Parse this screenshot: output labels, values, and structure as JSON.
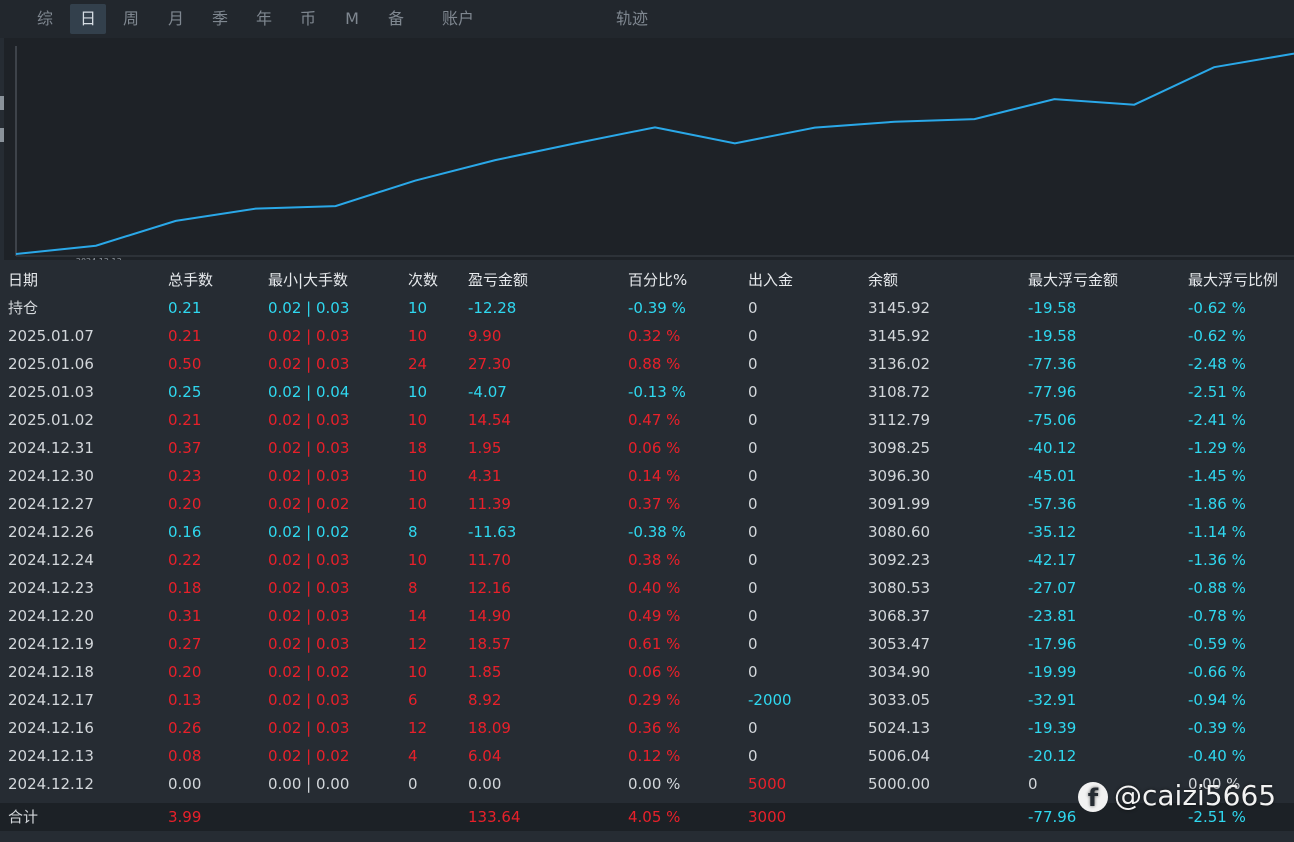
{
  "tabs": [
    {
      "label": "综",
      "active": false
    },
    {
      "label": "日",
      "active": true
    },
    {
      "label": "周",
      "active": false
    },
    {
      "label": "月",
      "active": false
    },
    {
      "label": "季",
      "active": false
    },
    {
      "label": "年",
      "active": false
    },
    {
      "label": "币",
      "active": false
    },
    {
      "label": "M",
      "active": false
    },
    {
      "label": "备",
      "active": false
    },
    {
      "label": "账户",
      "active": false
    },
    {
      "label": "轨迹",
      "active": false
    }
  ],
  "chart_data": {
    "type": "line",
    "x_tick_label": "2024.12.13",
    "x": [
      "2024.12.12",
      "2024.12.13",
      "2024.12.16",
      "2024.12.17",
      "2024.12.18",
      "2024.12.19",
      "2024.12.20",
      "2024.12.23",
      "2024.12.24",
      "2024.12.26",
      "2024.12.27",
      "2024.12.30",
      "2024.12.31",
      "2025.01.02",
      "2025.01.03",
      "2025.01.06",
      "2025.01.07"
    ],
    "y": [
      0,
      6.04,
      24.13,
      33.05,
      34.9,
      53.47,
      68.37,
      80.53,
      92.23,
      80.6,
      91.99,
      96.3,
      98.25,
      112.79,
      108.72,
      136.02,
      145.92
    ],
    "line_color": "#2aa8e8",
    "ylim": [
      0,
      150
    ]
  },
  "table": {
    "headers": [
      "日期",
      "总手数",
      "最小|大手数",
      "次数",
      "盈亏金额",
      "百分比%",
      "出入金",
      "余额",
      "最大浮亏金额",
      "最大浮亏比例"
    ],
    "rows": [
      {
        "date": "持仓",
        "lots": "0.21",
        "minmax": "0.02 | 0.03",
        "count": "10",
        "pnl": "-12.28",
        "pct": "-0.39 %",
        "flow": "0",
        "balance": "3145.92",
        "mdd": "-19.58",
        "mddpct": "-0.62 %",
        "color": "cyan"
      },
      {
        "date": "2025.01.07",
        "lots": "0.21",
        "minmax": "0.02 | 0.03",
        "count": "10",
        "pnl": "9.90",
        "pct": "0.32 %",
        "flow": "0",
        "balance": "3145.92",
        "mdd": "-19.58",
        "mddpct": "-0.62 %",
        "color": "red"
      },
      {
        "date": "2025.01.06",
        "lots": "0.50",
        "minmax": "0.02 | 0.03",
        "count": "24",
        "pnl": "27.30",
        "pct": "0.88 %",
        "flow": "0",
        "balance": "3136.02",
        "mdd": "-77.36",
        "mddpct": "-2.48 %",
        "color": "red"
      },
      {
        "date": "2025.01.03",
        "lots": "0.25",
        "minmax": "0.02 | 0.04",
        "count": "10",
        "pnl": "-4.07",
        "pct": "-0.13 %",
        "flow": "0",
        "balance": "3108.72",
        "mdd": "-77.96",
        "mddpct": "-2.51 %",
        "color": "cyan"
      },
      {
        "date": "2025.01.02",
        "lots": "0.21",
        "minmax": "0.02 | 0.03",
        "count": "10",
        "pnl": "14.54",
        "pct": "0.47 %",
        "flow": "0",
        "balance": "3112.79",
        "mdd": "-75.06",
        "mddpct": "-2.41 %",
        "color": "red"
      },
      {
        "date": "2024.12.31",
        "lots": "0.37",
        "minmax": "0.02 | 0.03",
        "count": "18",
        "pnl": "1.95",
        "pct": "0.06 %",
        "flow": "0",
        "balance": "3098.25",
        "mdd": "-40.12",
        "mddpct": "-1.29 %",
        "color": "red"
      },
      {
        "date": "2024.12.30",
        "lots": "0.23",
        "minmax": "0.02 | 0.03",
        "count": "10",
        "pnl": "4.31",
        "pct": "0.14 %",
        "flow": "0",
        "balance": "3096.30",
        "mdd": "-45.01",
        "mddpct": "-1.45 %",
        "color": "red"
      },
      {
        "date": "2024.12.27",
        "lots": "0.20",
        "minmax": "0.02 | 0.02",
        "count": "10",
        "pnl": "11.39",
        "pct": "0.37 %",
        "flow": "0",
        "balance": "3091.99",
        "mdd": "-57.36",
        "mddpct": "-1.86 %",
        "color": "red"
      },
      {
        "date": "2024.12.26",
        "lots": "0.16",
        "minmax": "0.02 | 0.02",
        "count": "8",
        "pnl": "-11.63",
        "pct": "-0.38 %",
        "flow": "0",
        "balance": "3080.60",
        "mdd": "-35.12",
        "mddpct": "-1.14 %",
        "color": "cyan"
      },
      {
        "date": "2024.12.24",
        "lots": "0.22",
        "minmax": "0.02 | 0.03",
        "count": "10",
        "pnl": "11.70",
        "pct": "0.38 %",
        "flow": "0",
        "balance": "3092.23",
        "mdd": "-42.17",
        "mddpct": "-1.36 %",
        "color": "red"
      },
      {
        "date": "2024.12.23",
        "lots": "0.18",
        "minmax": "0.02 | 0.03",
        "count": "8",
        "pnl": "12.16",
        "pct": "0.40 %",
        "flow": "0",
        "balance": "3080.53",
        "mdd": "-27.07",
        "mddpct": "-0.88 %",
        "color": "red"
      },
      {
        "date": "2024.12.20",
        "lots": "0.31",
        "minmax": "0.02 | 0.03",
        "count": "14",
        "pnl": "14.90",
        "pct": "0.49 %",
        "flow": "0",
        "balance": "3068.37",
        "mdd": "-23.81",
        "mddpct": "-0.78 %",
        "color": "red"
      },
      {
        "date": "2024.12.19",
        "lots": "0.27",
        "minmax": "0.02 | 0.03",
        "count": "12",
        "pnl": "18.57",
        "pct": "0.61 %",
        "flow": "0",
        "balance": "3053.47",
        "mdd": "-17.96",
        "mddpct": "-0.59 %",
        "color": "red"
      },
      {
        "date": "2024.12.18",
        "lots": "0.20",
        "minmax": "0.02 | 0.02",
        "count": "10",
        "pnl": "1.85",
        "pct": "0.06 %",
        "flow": "0",
        "balance": "3034.90",
        "mdd": "-19.99",
        "mddpct": "-0.66 %",
        "color": "red"
      },
      {
        "date": "2024.12.17",
        "lots": "0.13",
        "minmax": "0.02 | 0.03",
        "count": "6",
        "pnl": "8.92",
        "pct": "0.29 %",
        "flow": "-2000",
        "balance": "3033.05",
        "mdd": "-32.91",
        "mddpct": "-0.94 %",
        "color": "red",
        "flowColor": "cyan"
      },
      {
        "date": "2024.12.16",
        "lots": "0.26",
        "minmax": "0.02 | 0.03",
        "count": "12",
        "pnl": "18.09",
        "pct": "0.36 %",
        "flow": "0",
        "balance": "5024.13",
        "mdd": "-19.39",
        "mddpct": "-0.39 %",
        "color": "red"
      },
      {
        "date": "2024.12.13",
        "lots": "0.08",
        "minmax": "0.02 | 0.02",
        "count": "4",
        "pnl": "6.04",
        "pct": "0.12 %",
        "flow": "0",
        "balance": "5006.04",
        "mdd": "-20.12",
        "mddpct": "-0.40 %",
        "color": "red"
      },
      {
        "date": "2024.12.12",
        "lots": "0.00",
        "minmax": "0.00 | 0.00",
        "count": "0",
        "pnl": "0.00",
        "pct": "0.00 %",
        "flow": "5000",
        "balance": "5000.00",
        "mdd": "0",
        "mddpct": "0.00 %",
        "color": "white",
        "flowColor": "red"
      }
    ],
    "total": {
      "label": "合计",
      "lots": "3.99",
      "pnl": "133.64",
      "pct": "4.05 %",
      "flow": "3000",
      "mdd": "-77.96",
      "mddpct": "-2.51 %"
    }
  },
  "watermark": {
    "icon": "facebook-icon",
    "text": "@caizi5665"
  },
  "colors": {
    "red": "#e8202a",
    "cyan": "#2fd8f0",
    "white": "#d3d7db",
    "line": "#2aa8e8",
    "background": "#262c33"
  }
}
